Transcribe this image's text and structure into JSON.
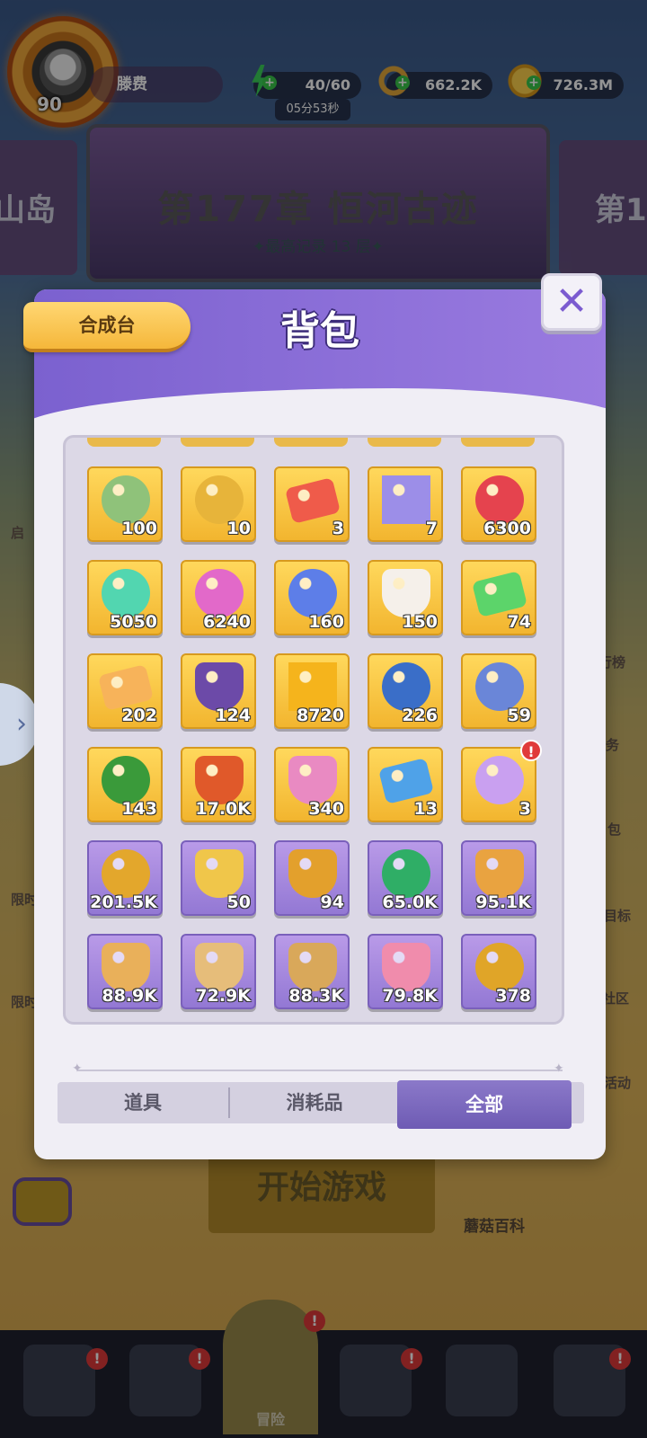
{
  "hud": {
    "level": "90",
    "player_name": "滕费",
    "energy": "40/60",
    "energy_timer": "05分53秒",
    "rings": "662.2K",
    "coins": "726.3M"
  },
  "chapter": {
    "title": "第177章 恒河古迹",
    "record": "✦最高记录 13 层✦",
    "left_partial": "山岛",
    "right_partial": "第1"
  },
  "background": {
    "start_button": "开始游戏",
    "wiki_label": "蘑菇百科",
    "adventure_label": "冒险",
    "side_labels": [
      "启",
      "限时",
      "限时",
      "行榜",
      "务",
      "包",
      "目标",
      "社区",
      "活动"
    ]
  },
  "modal": {
    "title": "背包",
    "craft_tab": "合成台",
    "close_glyph": "✕",
    "tabs": [
      {
        "label": "道具",
        "active": false
      },
      {
        "label": "消耗品",
        "active": false
      },
      {
        "label": "全部",
        "active": true
      }
    ],
    "items": [
      {
        "name": "jade-coin",
        "count": "100",
        "bg": "gold",
        "color": "#8fc27a"
      },
      {
        "name": "star-coin",
        "count": "10",
        "bg": "gold",
        "color": "#e7b43a"
      },
      {
        "name": "red-ticket",
        "count": "3",
        "bg": "gold",
        "color": "#ef5b4a"
      },
      {
        "name": "crystal-star",
        "count": "7",
        "bg": "gold",
        "color": "#9c8ee8"
      },
      {
        "name": "red-dice-coin",
        "count": "6300",
        "bg": "gold",
        "color": "#e5434e"
      },
      {
        "name": "teal-coin",
        "count": "5050",
        "bg": "gold",
        "color": "#52d6b0"
      },
      {
        "name": "pink-coin",
        "count": "6240",
        "bg": "gold",
        "color": "#e269c9"
      },
      {
        "name": "blue-coin",
        "count": "160",
        "bg": "gold",
        "color": "#5d7ee8"
      },
      {
        "name": "dice",
        "count": "150",
        "bg": "gold",
        "color": "#f5f0ea"
      },
      {
        "name": "green-ticket",
        "count": "74",
        "bg": "gold",
        "color": "#5cd46a"
      },
      {
        "name": "orange-ticket",
        "count": "202",
        "bg": "gold",
        "color": "#f7b35a"
      },
      {
        "name": "purple-egg",
        "count": "124",
        "bg": "gold",
        "color": "#6c4aa8"
      },
      {
        "name": "gold-star",
        "count": "8720",
        "bg": "gold",
        "color": "#f5b41c"
      },
      {
        "name": "pearl-shell",
        "count": "226",
        "bg": "gold",
        "color": "#3a6ec8"
      },
      {
        "name": "silver-ring",
        "count": "59",
        "bg": "gold",
        "color": "#6a86d8"
      },
      {
        "name": "pearl-leaf",
        "count": "143",
        "bg": "gold",
        "color": "#3a9a3a"
      },
      {
        "name": "amber-gem",
        "count": "17.0K",
        "bg": "gold",
        "color": "#e0592a"
      },
      {
        "name": "rainbow-egg",
        "count": "340",
        "bg": "gold",
        "color": "#e98ac2"
      },
      {
        "name": "blue-ticket",
        "count": "13",
        "bg": "gold",
        "color": "#4fa2e8"
      },
      {
        "name": "mystery-orb",
        "count": "3",
        "bg": "gold",
        "color": "#c9a0f0",
        "alert": "!"
      },
      {
        "name": "gold-medal",
        "count": "201.5K",
        "bg": "purple",
        "color": "#e3a72c"
      },
      {
        "name": "gold-nuggets",
        "count": "50",
        "bg": "purple",
        "color": "#f0c64a"
      },
      {
        "name": "shovel",
        "count": "94",
        "bg": "purple",
        "color": "#e3a02c"
      },
      {
        "name": "flower",
        "count": "65.0K",
        "bg": "purple",
        "color": "#2fae66"
      },
      {
        "name": "book",
        "count": "95.1K",
        "bg": "purple",
        "color": "#e9a340"
      },
      {
        "name": "arrow",
        "count": "88.9K",
        "bg": "purple",
        "color": "#e9b05a"
      },
      {
        "name": "pickaxe",
        "count": "72.9K",
        "bg": "purple",
        "color": "#e6bd7a"
      },
      {
        "name": "conch",
        "count": "88.3K",
        "bg": "purple",
        "color": "#d9a85a"
      },
      {
        "name": "pink-crystal",
        "count": "79.8K",
        "bg": "purple",
        "color": "#f08cac"
      },
      {
        "name": "gold-lamp",
        "count": "378",
        "bg": "purple",
        "color": "#e0a528"
      }
    ]
  },
  "nav": {
    "badges": [
      "!",
      "!",
      "!",
      "!",
      "!"
    ]
  }
}
